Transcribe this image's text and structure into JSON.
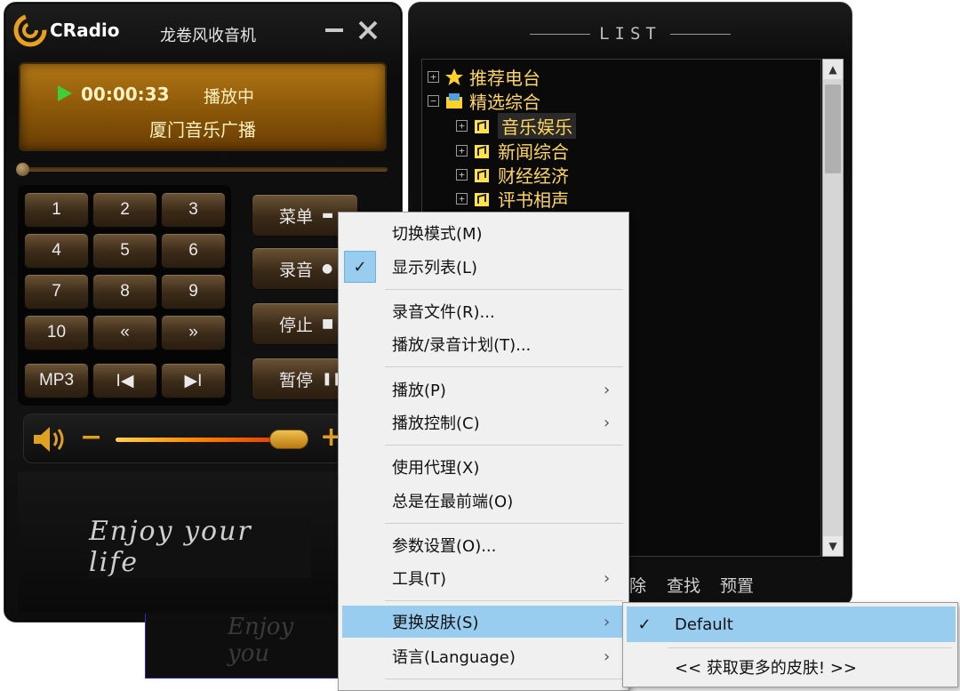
{
  "player": {
    "app_name": "CRadio",
    "subtitle": "龙卷风收音机",
    "display": {
      "time": "00:00:33",
      "state": "播放中",
      "station": "厦门音乐广播"
    },
    "keys": [
      "1",
      "2",
      "3",
      "4",
      "5",
      "6",
      "7",
      "8",
      "9",
      "10",
      "«",
      "»",
      "MP3",
      "I◀",
      "▶I"
    ],
    "side_buttons": {
      "menu": "菜单",
      "record": "录音",
      "stop": "停止",
      "pause": "暂停"
    },
    "volume_level": 0.82,
    "slogan": "Enjoy your life",
    "colors": {
      "accent": "#e0a020",
      "display": "#8a5608",
      "text_gold": "#ffd65a"
    }
  },
  "list": {
    "title": "LIST",
    "tree": [
      {
        "label": "推荐电台",
        "icon": "star-icon",
        "level": 0
      },
      {
        "label": "精选综合",
        "icon": "folder-icon",
        "level": 0
      },
      {
        "label": "音乐娱乐",
        "icon": "radio-icon",
        "level": 1,
        "selected": true
      },
      {
        "label": "新闻综合",
        "icon": "radio-icon",
        "level": 1
      },
      {
        "label": "财经经济",
        "icon": "radio-icon",
        "level": 1
      },
      {
        "label": "评书相声",
        "icon": "radio-icon",
        "level": 1
      }
    ],
    "footer": {
      "delete": "除",
      "find": "查找",
      "preset": "预置"
    }
  },
  "menu": {
    "items": [
      {
        "label": "切换模式(M)"
      },
      {
        "label": "显示列表(L)",
        "checked": true
      },
      {
        "label": "录音文件(R)..."
      },
      {
        "label": "播放/录音计划(T)..."
      },
      {
        "label": "播放(P)",
        "submenu": true
      },
      {
        "label": "播放控制(C)",
        "submenu": true
      },
      {
        "label": "使用代理(X)"
      },
      {
        "label": "总是在最前端(O)"
      },
      {
        "label": "参数设置(O)..."
      },
      {
        "label": "工具(T)",
        "submenu": true
      },
      {
        "label": "更换皮肤(S)",
        "submenu": true,
        "highlighted": true
      },
      {
        "label": "语言(Language)",
        "submenu": true
      }
    ]
  },
  "skin_submenu": {
    "items": [
      {
        "label": "Default",
        "checked": true
      },
      {
        "label": "<< 获取更多的皮肤! >>"
      }
    ]
  }
}
